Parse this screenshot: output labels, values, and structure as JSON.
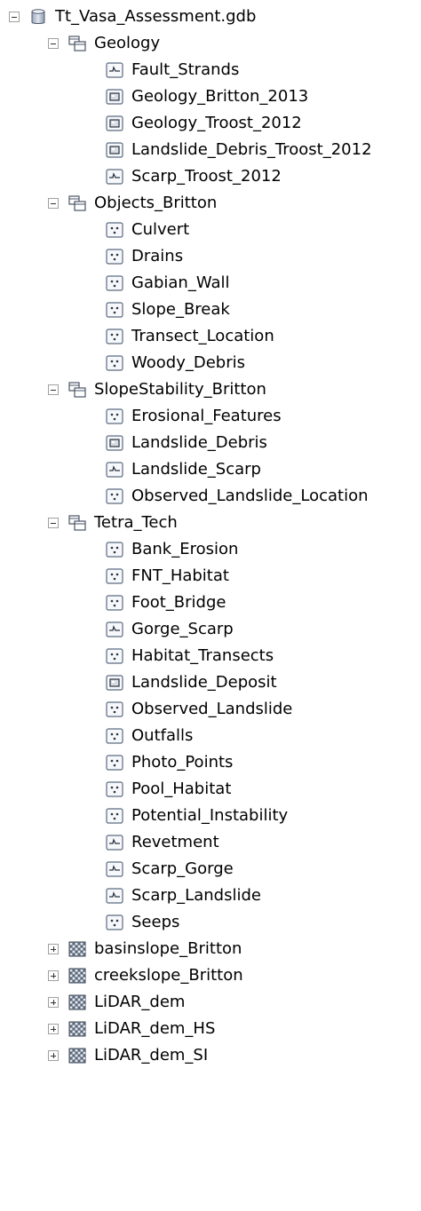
{
  "tree": {
    "root": {
      "label": "Tt_Vasa_Assessment.gdb",
      "icon": "database-icon",
      "expanded": true
    },
    "datasets": [
      {
        "label": "Geology",
        "icon": "feature-dataset-icon",
        "expanded": true,
        "items": [
          {
            "label": "Fault_Strands",
            "icon": "line-feature-class-icon"
          },
          {
            "label": "Geology_Britton_2013",
            "icon": "polygon-feature-class-icon"
          },
          {
            "label": "Geology_Troost_2012",
            "icon": "polygon-feature-class-icon"
          },
          {
            "label": "Landslide_Debris_Troost_2012",
            "icon": "polygon-feature-class-icon"
          },
          {
            "label": "Scarp_Troost_2012",
            "icon": "line-feature-class-icon"
          }
        ]
      },
      {
        "label": "Objects_Britton",
        "icon": "feature-dataset-icon",
        "expanded": true,
        "items": [
          {
            "label": "Culvert",
            "icon": "point-feature-class-icon"
          },
          {
            "label": "Drains",
            "icon": "point-feature-class-icon"
          },
          {
            "label": "Gabian_Wall",
            "icon": "point-feature-class-icon"
          },
          {
            "label": "Slope_Break",
            "icon": "point-feature-class-icon"
          },
          {
            "label": "Transect_Location",
            "icon": "point-feature-class-icon"
          },
          {
            "label": "Woody_Debris",
            "icon": "point-feature-class-icon"
          }
        ]
      },
      {
        "label": "SlopeStability_Britton",
        "icon": "feature-dataset-icon",
        "expanded": true,
        "items": [
          {
            "label": "Erosional_Features",
            "icon": "point-feature-class-icon"
          },
          {
            "label": "Landslide_Debris",
            "icon": "polygon-feature-class-icon"
          },
          {
            "label": "Landslide_Scarp",
            "icon": "line-feature-class-icon"
          },
          {
            "label": "Observed_Landslide_Location",
            "icon": "point-feature-class-icon"
          }
        ]
      },
      {
        "label": "Tetra_Tech",
        "icon": "feature-dataset-icon",
        "expanded": true,
        "items": [
          {
            "label": "Bank_Erosion",
            "icon": "point-feature-class-icon"
          },
          {
            "label": "FNT_Habitat",
            "icon": "point-feature-class-icon"
          },
          {
            "label": "Foot_Bridge",
            "icon": "point-feature-class-icon"
          },
          {
            "label": "Gorge_Scarp",
            "icon": "line-feature-class-icon"
          },
          {
            "label": "Habitat_Transects",
            "icon": "point-feature-class-icon"
          },
          {
            "label": "Landslide_Deposit",
            "icon": "polygon-feature-class-icon"
          },
          {
            "label": "Observed_Landslide",
            "icon": "point-feature-class-icon"
          },
          {
            "label": "Outfalls",
            "icon": "point-feature-class-icon"
          },
          {
            "label": "Photo_Points",
            "icon": "point-feature-class-icon"
          },
          {
            "label": "Pool_Habitat",
            "icon": "point-feature-class-icon"
          },
          {
            "label": "Potential_Instability",
            "icon": "point-feature-class-icon"
          },
          {
            "label": "Revetment",
            "icon": "line-feature-class-icon"
          },
          {
            "label": "Scarp_Gorge",
            "icon": "line-feature-class-icon"
          },
          {
            "label": "Scarp_Landslide",
            "icon": "line-feature-class-icon"
          },
          {
            "label": "Seeps",
            "icon": "point-feature-class-icon"
          }
        ]
      }
    ],
    "rasters": [
      {
        "label": "basinslope_Britton",
        "icon": "raster-icon",
        "expanded": false
      },
      {
        "label": "creekslope_Britton",
        "icon": "raster-icon",
        "expanded": false
      },
      {
        "label": "LiDAR_dem",
        "icon": "raster-icon",
        "expanded": false
      },
      {
        "label": "LiDAR_dem_HS",
        "icon": "raster-icon",
        "expanded": false
      },
      {
        "label": "LiDAR_dem_SI",
        "icon": "raster-icon",
        "expanded": false
      }
    ]
  }
}
